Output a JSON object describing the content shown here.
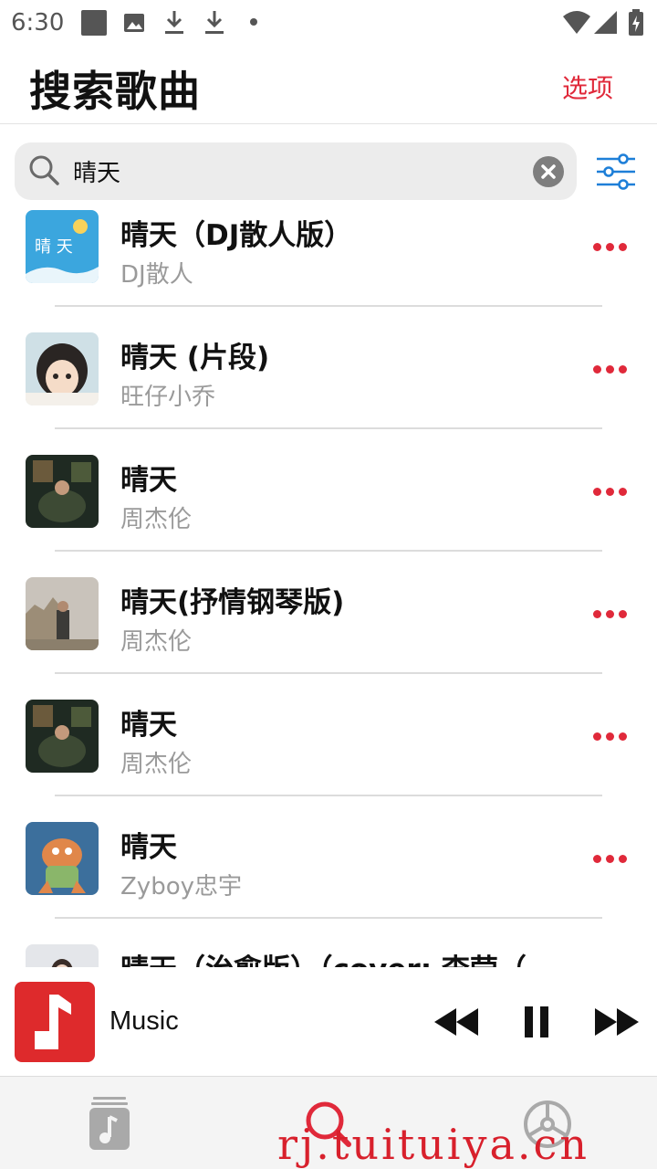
{
  "status_bar": {
    "time": "6:30",
    "left_icons": [
      "square-notification-icon",
      "image-icon",
      "download-icon",
      "download-icon",
      "dot-icon"
    ],
    "right_icons": [
      "wifi-icon",
      "signal-icon",
      "battery-charging-icon"
    ]
  },
  "header": {
    "title": "搜索歌曲",
    "options_label": "选项"
  },
  "search": {
    "value": "晴天",
    "placeholder": "",
    "icon": "search-icon",
    "clear_icon": "clear-icon",
    "filter_icon": "sliders-icon"
  },
  "results": [
    {
      "title": "晴天（DJ散人版）",
      "artist": "DJ散人"
    },
    {
      "title": "晴天 (片段)",
      "artist": "旺仔小乔"
    },
    {
      "title": "晴天",
      "artist": "周杰伦"
    },
    {
      "title": "晴天(抒情钢琴版)",
      "artist": "周杰伦"
    },
    {
      "title": "晴天",
      "artist": "周杰伦"
    },
    {
      "title": "晴天",
      "artist": "Zyboy忠宇"
    },
    {
      "title": "晴天（治愈版）（cover: 李莹（…",
      "artist": ""
    }
  ],
  "player": {
    "title": "Music",
    "controls": [
      "rewind-icon",
      "pause-icon",
      "fast-forward-icon"
    ]
  },
  "tabs": [
    {
      "name": "library",
      "icon": "music-library-icon",
      "active": false
    },
    {
      "name": "search",
      "icon": "search-icon",
      "active": true
    },
    {
      "name": "settings",
      "icon": "settings-icon",
      "active": false
    }
  ],
  "watermark": "rj.tuituiya.cn",
  "colors": {
    "accent": "#e0293a",
    "filter_blue": "#1e7fd8",
    "secondary_text": "#9a9a9a"
  }
}
